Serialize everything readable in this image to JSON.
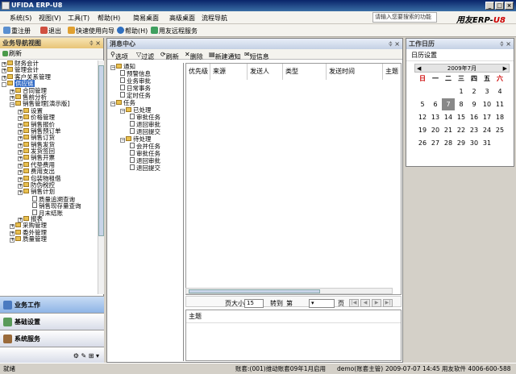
{
  "window": {
    "title": "UFIDA ERP-U8",
    "min": "_",
    "max": "□",
    "close": "×"
  },
  "menu": [
    "系统(S)",
    "视图(V)",
    "工具(T)",
    "帮助(H)",
    "简易桌面",
    "高级桌面",
    "流程导航"
  ],
  "search": {
    "label": "请输入您要搜索的功能"
  },
  "brand": {
    "text": "用友ERP-U8",
    "prefix": "用友ERP-",
    "suffix": "U8"
  },
  "toolbar": [
    "重注册",
    "退出",
    "快速使用向导",
    "帮助(H)",
    "用友远程服务"
  ],
  "left_panel": {
    "title": "业务导航视图",
    "refresh": "刷新",
    "tree": [
      {
        "label": "财务会计",
        "level": 0,
        "kind": "plus"
      },
      {
        "label": "管理会计",
        "level": 0,
        "kind": "plus"
      },
      {
        "label": "客户关系管理",
        "level": 0,
        "kind": "plus"
      },
      {
        "label": "供应链",
        "level": 0,
        "kind": "minus"
      },
      {
        "label": "合同管理",
        "level": 1,
        "kind": "plus"
      },
      {
        "label": "售前分析",
        "level": 1,
        "kind": "plus"
      },
      {
        "label": "销售管理[演示版]",
        "level": 1,
        "kind": "minus"
      },
      {
        "label": "设置",
        "level": 2,
        "kind": "plus"
      },
      {
        "label": "价格管理",
        "level": 2,
        "kind": "plus"
      },
      {
        "label": "销售报价",
        "level": 2,
        "kind": "plus"
      },
      {
        "label": "销售预订单",
        "level": 2,
        "kind": "plus"
      },
      {
        "label": "销售订货",
        "level": 2,
        "kind": "plus"
      },
      {
        "label": "销售发货",
        "level": 2,
        "kind": "plus"
      },
      {
        "label": "发货签回",
        "level": 2,
        "kind": "plus"
      },
      {
        "label": "销售开票",
        "level": 2,
        "kind": "plus"
      },
      {
        "label": "代垫费用",
        "level": 2,
        "kind": "plus"
      },
      {
        "label": "费用支出",
        "level": 2,
        "kind": "plus"
      },
      {
        "label": "包装物租借",
        "level": 2,
        "kind": "plus"
      },
      {
        "label": "防伪税控",
        "level": 2,
        "kind": "plus"
      },
      {
        "label": "销售计划",
        "level": 2,
        "kind": "plus"
      },
      {
        "label": "质量追溯查询",
        "level": 3,
        "kind": "doc"
      },
      {
        "label": "销售现存量查询",
        "level": 3,
        "kind": "doc"
      },
      {
        "label": "月末结账",
        "level": 3,
        "kind": "doc"
      },
      {
        "label": "报表",
        "level": 2,
        "kind": "plus"
      },
      {
        "label": "采购管理",
        "level": 1,
        "kind": "plus"
      },
      {
        "label": "委外管理",
        "level": 1,
        "kind": "plus"
      },
      {
        "label": "质量管理",
        "level": 1,
        "kind": "plus"
      }
    ],
    "nav_buttons": [
      "业务工作",
      "基础设置",
      "系统服务"
    ]
  },
  "message_center": {
    "title": "消息中心",
    "toolbar": [
      "选项",
      "过滤",
      "刷新",
      "删除",
      "新建通知",
      "短信息"
    ],
    "tree": [
      {
        "label": "通知",
        "level": 0,
        "kind": "minus"
      },
      {
        "label": "预警信息",
        "level": 1,
        "kind": "doc"
      },
      {
        "label": "业务审批",
        "level": 1,
        "kind": "doc"
      },
      {
        "label": "日常事务",
        "level": 1,
        "kind": "doc"
      },
      {
        "label": "定时任务",
        "level": 1,
        "kind": "doc"
      },
      {
        "label": "任务",
        "level": 0,
        "kind": "minus"
      },
      {
        "label": "已处理",
        "level": 1,
        "kind": "minus"
      },
      {
        "label": "审批任务",
        "level": 2,
        "kind": "doc"
      },
      {
        "label": "退回审批",
        "level": 2,
        "kind": "doc"
      },
      {
        "label": "退回提交",
        "level": 2,
        "kind": "doc"
      },
      {
        "label": "待处理",
        "level": 1,
        "kind": "minus"
      },
      {
        "label": "会并任务",
        "level": 2,
        "kind": "doc"
      },
      {
        "label": "审批任务",
        "level": 2,
        "kind": "doc"
      },
      {
        "label": "退回审批",
        "level": 2,
        "kind": "doc"
      },
      {
        "label": "退回提交",
        "level": 2,
        "kind": "doc"
      }
    ],
    "columns": [
      "优先级",
      "来源",
      "发送人",
      "类型",
      "发送时间",
      "主题"
    ],
    "pager": {
      "page_size_label": "页大小",
      "page_size": "15",
      "goto_label": "转到",
      "page_label": "第",
      "page_unit": "页"
    },
    "subject_label": "主题"
  },
  "calendar": {
    "title": "工作日历",
    "settings": "日历设置",
    "month_label": "2009年7月",
    "weekdays": [
      "日",
      "一",
      "二",
      "三",
      "四",
      "五",
      "六"
    ],
    "weeks": [
      [
        "",
        "",
        "",
        "1",
        "2",
        "3",
        "4"
      ],
      [
        "5",
        "6",
        "7",
        "8",
        "9",
        "10",
        "11"
      ],
      [
        "12",
        "13",
        "14",
        "15",
        "16",
        "17",
        "18"
      ],
      [
        "19",
        "20",
        "21",
        "22",
        "23",
        "24",
        "25"
      ],
      [
        "26",
        "27",
        "28",
        "29",
        "30",
        "31",
        ""
      ]
    ],
    "today": "7"
  },
  "statusbar": {
    "ready": "就绪",
    "account": "账套:(001)维动账套09年1月启用",
    "user": "demo(账套主管)",
    "datetime": "2009-07-07 14:45",
    "company": "用友软件 4006-600-588"
  }
}
